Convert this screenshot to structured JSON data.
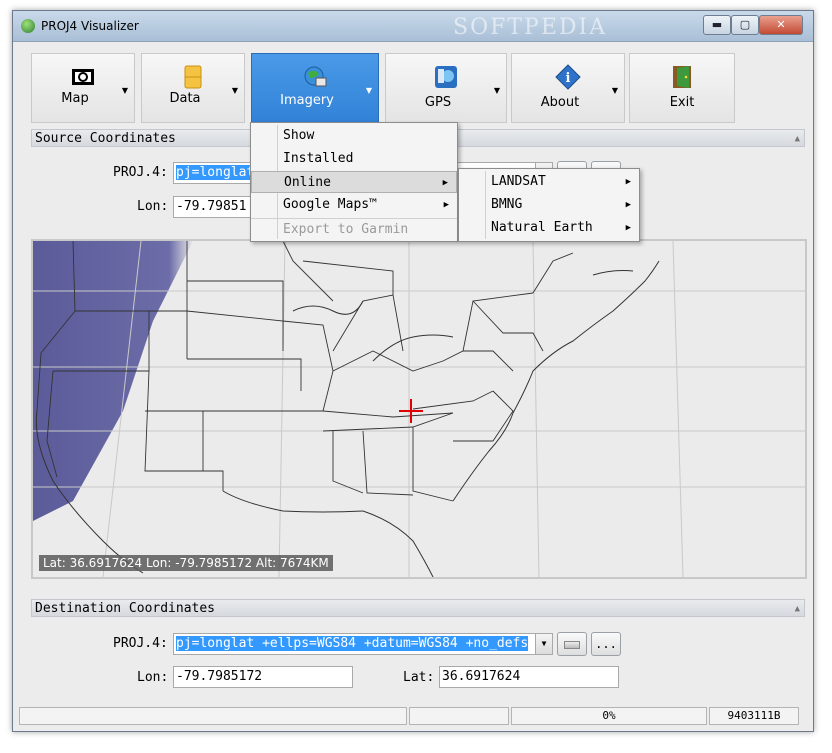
{
  "window": {
    "title": "PROJ4 Visualizer",
    "watermark": "SOFTPEDIA",
    "minimize": "▬",
    "maximize": "▢",
    "close": "✕"
  },
  "toolbar": {
    "map": "Map",
    "data": "Data",
    "imagery": "Imagery",
    "gps": "GPS",
    "about": "About",
    "exit": "Exit"
  },
  "source": {
    "header": "Source Coordinates",
    "proj_label": "PROJ.4:",
    "proj_value": "pj=longlat",
    "lon_label": "Lon:",
    "lon_value": "-79.79851"
  },
  "map": {
    "status": "Lat: 36.6917624  Lon: -79.7985172 Alt: 7674KM"
  },
  "destination": {
    "header": "Destination Coordinates",
    "proj_label": "PROJ.4:",
    "proj_value": "pj=longlat +ellps=WGS84 +datum=WGS84 +no_defs",
    "lon_label": "Lon:",
    "lon_value": "-79.7985172",
    "lat_label": "Lat:",
    "lat_value": "36.6917624",
    "more_button": "..."
  },
  "imagery_menu": {
    "show": "Show",
    "installed": "Installed",
    "online": "Online",
    "google_maps": "Google Maps™",
    "export_garmin": "Export to Garmin"
  },
  "online_submenu": {
    "landsat": "LANDSAT",
    "bmng": "BMNG",
    "natural_earth": "Natural Earth"
  },
  "statusbar": {
    "progress": "0%",
    "memory": "9403111B"
  }
}
